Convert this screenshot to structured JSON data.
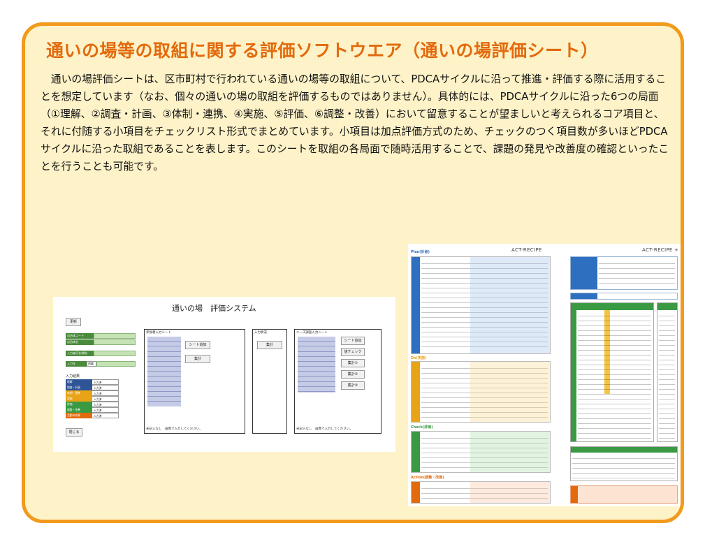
{
  "title": "通いの場等の取組に関する評価ソフトウエア（通いの場評価シート）",
  "description": "　通いの場評価シートは、区市町村で行われている通いの場等の取組について、PDCAサイクルに沿って推進・評価する際に活用することを想定しています（なお、個々の通いの場の取組を評価するものではありません）。具体的には、PDCAサイクルに沿った6つの局面（①理解、②調査・計画、③体制・連携、④実施、⑤評価、⑥調整・改善）において留意することが望ましいと考えられるコア項目と、それに付随する小項目をチェックリスト形式でまとめています。小項目は加点評価方式のため、チェックのつく項目数が多いほどPDCAサイクルに沿った取組であることを表します。このシートを取組の各局面で随時活用することで、課題の発見や改善度の確認といったことを行うことも可能です。",
  "colors": {
    "border": "#f29a1c",
    "panel_bg": "#fef2c8",
    "title": "#e36a0c"
  },
  "system_screenshot": {
    "title": "通いの場　評価システム",
    "update_button": "更新",
    "fields": {
      "municipality_code": "自治体コード",
      "municipality_name": "自治体名",
      "entry_date": "入力者氏名/課名",
      "input_year": "入力年",
      "year_value": "西暦"
    },
    "results_label": "入力結果",
    "result_rows": [
      "理解",
      "調査・計画",
      "体制・連携",
      "実施",
      "評価",
      "調整・改善",
      "活動の成果"
    ],
    "result_value": "入力済",
    "close_button": "閉じる",
    "participant_panel": {
      "caption": "参加者入力シート",
      "add_button": "シート追加",
      "aggregate_button": "集計",
      "note": "未記入なし　画像で入力してください。"
    },
    "input_panel": {
      "caption": "入力状況",
      "aggregate_button": "集計"
    },
    "needs_panel": {
      "caption": "ニーズ調査入力シート",
      "add_button": "シート追加",
      "check_button": "値チェック",
      "aggregate1": "集計①",
      "aggregate2": "集計②",
      "aggregate3": "集計③",
      "note": "未記入なし　画像で入力してください。"
    }
  },
  "recipe_screenshot": {
    "header_left": "ACT-RECIPE",
    "header_right": "ACT-RECIPE +",
    "sections": [
      {
        "label": "Plan(計画)",
        "color": "#2f6fc0"
      },
      {
        "label": "Do(実施)",
        "color": "#e8a317"
      },
      {
        "label": "Check(評価)",
        "color": "#3a9a43"
      },
      {
        "label": "Action(調整・改善)",
        "color": "#e36a0c"
      }
    ]
  }
}
